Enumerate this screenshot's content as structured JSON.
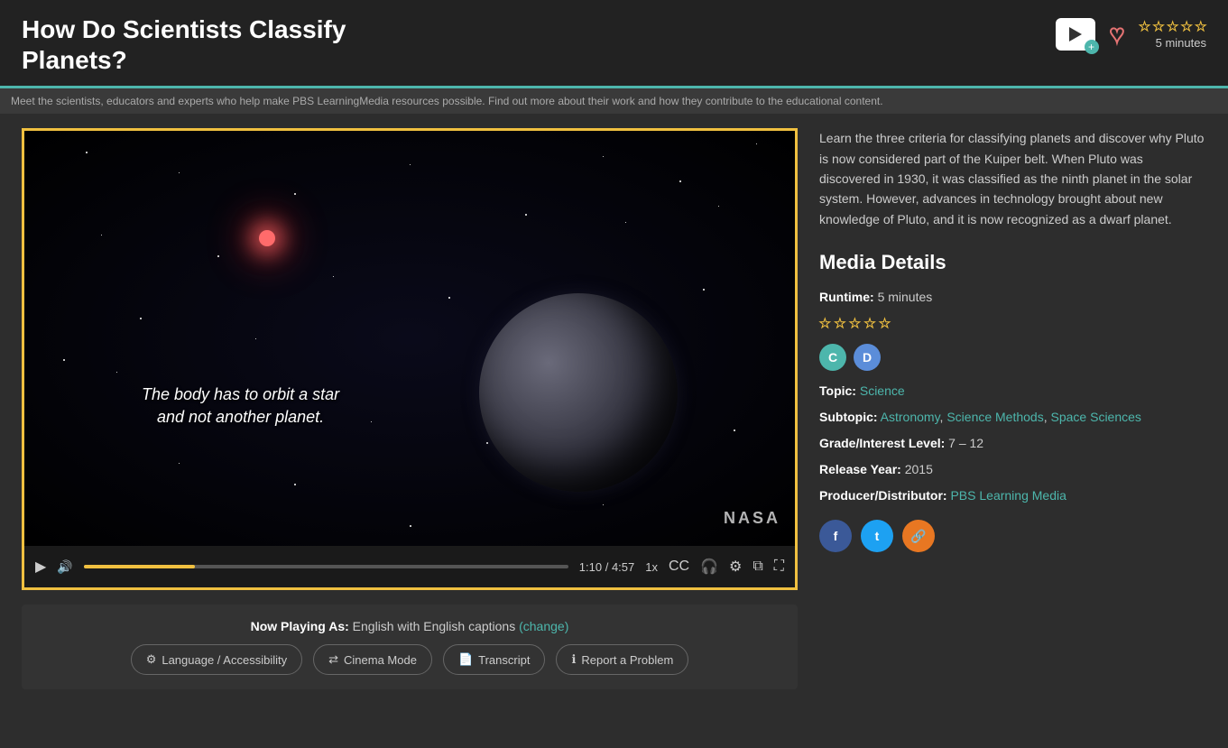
{
  "header": {
    "title_line1": "How Do Scientists Classify",
    "title_line2": "Planets?",
    "duration": "5 minutes",
    "stars": [
      false,
      false,
      false,
      false,
      false
    ]
  },
  "video": {
    "caption": "The body has to orbit a star\nand not another planet.",
    "current_time": "1:10",
    "total_time": "4:57",
    "speed": "1x",
    "nasa_watermark": "NASA",
    "progress_percent": 23
  },
  "below_video": {
    "now_playing_label": "Now Playing As:",
    "now_playing_value": "English with English captions",
    "change_label": "(change)",
    "buttons": [
      {
        "id": "language-accessibility",
        "icon": "⚙",
        "label": "Language / Accessibility"
      },
      {
        "id": "cinema-mode",
        "icon": "⇄",
        "label": "Cinema Mode"
      },
      {
        "id": "transcript",
        "icon": "📄",
        "label": "Transcript"
      },
      {
        "id": "report-problem",
        "icon": "ℹ",
        "label": "Report a Problem"
      }
    ]
  },
  "right_panel": {
    "description": "Learn the three criteria for classifying planets and discover why Pluto is now considered part of the Kuiper belt. When Pluto was discovered in 1930, it was classified as the ninth planet in the solar system. However, advances in technology brought about new knowledge of Pluto, and it is now recognized as a dwarf planet.",
    "media_details_title": "Media Details",
    "runtime_label": "Runtime:",
    "runtime_value": "5 minutes",
    "topic_label": "Topic:",
    "topic_value": "Science",
    "subtopic_label": "Subtopic:",
    "subtopics": [
      "Astronomy",
      "Science Methods",
      "Space Sciences"
    ],
    "grade_label": "Grade/Interest Level:",
    "grade_value": "7 – 12",
    "release_label": "Release Year:",
    "release_value": "2015",
    "producer_label": "Producer/Distributor:",
    "producer_value": "PBS Learning Media",
    "badges": [
      {
        "letter": "C",
        "type": "c"
      },
      {
        "letter": "D",
        "type": "d"
      }
    ],
    "social": [
      {
        "id": "facebook",
        "letter": "f",
        "type": "fb"
      },
      {
        "id": "twitter",
        "letter": "t",
        "type": "tw"
      },
      {
        "id": "link",
        "letter": "🔗",
        "type": "link"
      }
    ]
  },
  "scrolling_bar": "Meet the scientists, educators and experts who help make PBS LearningMedia resources possible. Find out more about their work and how they contribute to the educational content."
}
